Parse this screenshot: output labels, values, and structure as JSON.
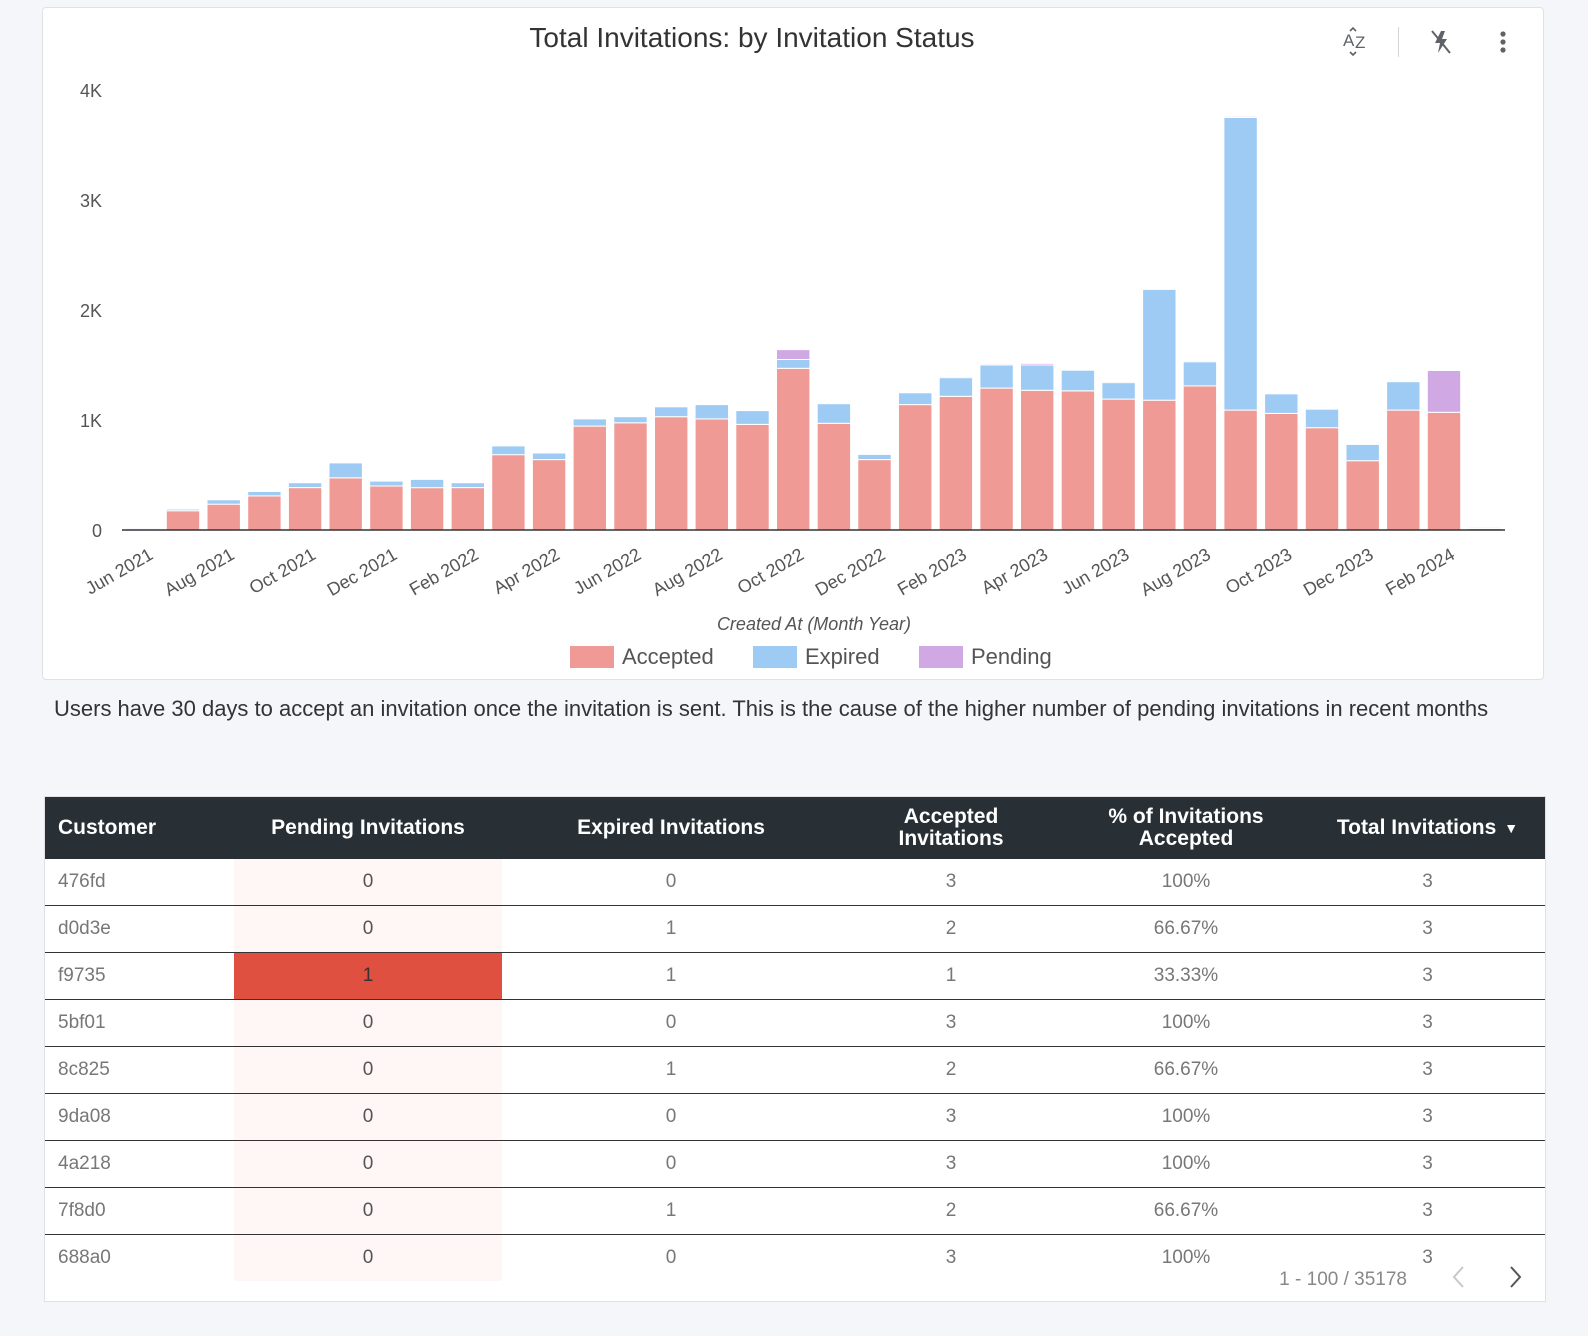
{
  "chart": {
    "title": "Total Invitations: by Invitation Status",
    "toolbar": {
      "sort_icon": "sort-az-icon",
      "filter_icon": "cross-filter-off-icon",
      "menu_icon": "more-vert-icon"
    }
  },
  "chart_data": {
    "type": "bar",
    "stacked": true,
    "title": "Total Invitations: by Invitation Status",
    "xlabel": "Created At (Month Year)",
    "ylabel": "",
    "ylim": [
      0,
      4000
    ],
    "y_ticks": [
      "0",
      "1K",
      "2K",
      "3K",
      "4K"
    ],
    "x_tick_labels": [
      "Jun 2021",
      "Aug 2021",
      "Oct 2021",
      "Dec 2021",
      "Feb 2022",
      "Apr 2022",
      "Jun 2022",
      "Aug 2022",
      "Oct 2022",
      "Dec 2022",
      "Feb 2023",
      "Apr 2023",
      "Jun 2023",
      "Aug 2023",
      "Oct 2023",
      "Dec 2023",
      "Feb 2024"
    ],
    "categories": [
      "Jun 2021",
      "Jul 2021",
      "Aug 2021",
      "Sep 2021",
      "Oct 2021",
      "Nov 2021",
      "Dec 2021",
      "Jan 2022",
      "Feb 2022",
      "Mar 2022",
      "Apr 2022",
      "May 2022",
      "Jun 2022",
      "Jul 2022",
      "Aug 2022",
      "Sep 2022",
      "Oct 2022",
      "Nov 2022",
      "Dec 2022",
      "Jan 2023",
      "Feb 2023",
      "Mar 2023",
      "Apr 2023",
      "May 2023",
      "Jun 2023",
      "Jul 2023",
      "Aug 2023",
      "Sep 2023",
      "Oct 2023",
      "Nov 2023",
      "Dec 2023",
      "Jan 2024",
      "Feb 2024",
      "Mar 2024"
    ],
    "series": [
      {
        "name": "Accepted",
        "color": "#ef9a94",
        "values": [
          10,
          175,
          235,
          310,
          385,
          475,
          400,
          385,
          385,
          685,
          640,
          945,
          975,
          1030,
          1010,
          960,
          1470,
          970,
          640,
          1140,
          1215,
          1290,
          1270,
          1265,
          1190,
          1180,
          1310,
          1090,
          1060,
          930,
          630,
          1090,
          1070,
          15
        ]
      },
      {
        "name": "Expired",
        "color": "#9dcbf3",
        "values": [
          10,
          15,
          40,
          40,
          45,
          135,
          45,
          75,
          45,
          80,
          60,
          65,
          55,
          90,
          130,
          125,
          80,
          180,
          50,
          110,
          170,
          210,
          230,
          190,
          150,
          1010,
          220,
          2660,
          180,
          170,
          150,
          260,
          0,
          10
        ]
      },
      {
        "name": "Pending",
        "color": "#d0a8e4",
        "values": [
          0,
          0,
          0,
          0,
          0,
          0,
          0,
          0,
          0,
          0,
          0,
          0,
          0,
          0,
          0,
          0,
          90,
          5,
          5,
          5,
          10,
          10,
          15,
          5,
          10,
          5,
          10,
          10,
          5,
          5,
          5,
          5,
          380,
          0
        ]
      }
    ],
    "legend": [
      "Accepted",
      "Expired",
      "Pending"
    ],
    "legend_position": "bottom",
    "grid": false
  },
  "note": "Users have 30 days to accept an invitation once the invitation is sent. This is the cause of the higher number of pending invitations in recent months",
  "table": {
    "headers": {
      "customer": "Customer",
      "pending": "Pending Invitations",
      "expired": "Expired Invitations",
      "accepted_1": "Accepted",
      "accepted_2": "Invitations",
      "pct_1": "% of Invitations",
      "pct_2": "Accepted",
      "total": "Total Invitations"
    },
    "sort_icon": "sort-desc-icon",
    "rows": [
      {
        "customer": "476fd",
        "pending": "0",
        "expired": "0",
        "accepted": "3",
        "pct": "100%",
        "total": "3"
      },
      {
        "customer": "d0d3e",
        "pending": "0",
        "expired": "1",
        "accepted": "2",
        "pct": "66.67%",
        "total": "3"
      },
      {
        "customer": "f9735",
        "pending": "1",
        "expired": "1",
        "accepted": "1",
        "pct": "33.33%",
        "total": "3"
      },
      {
        "customer": "5bf01",
        "pending": "0",
        "expired": "0",
        "accepted": "3",
        "pct": "100%",
        "total": "3"
      },
      {
        "customer": "8c825",
        "pending": "0",
        "expired": "1",
        "accepted": "2",
        "pct": "66.67%",
        "total": "3"
      },
      {
        "customer": "9da08",
        "pending": "0",
        "expired": "0",
        "accepted": "3",
        "pct": "100%",
        "total": "3"
      },
      {
        "customer": "4a218",
        "pending": "0",
        "expired": "0",
        "accepted": "3",
        "pct": "100%",
        "total": "3"
      },
      {
        "customer": "7f8d0",
        "pending": "0",
        "expired": "1",
        "accepted": "2",
        "pct": "66.67%",
        "total": "3"
      },
      {
        "customer": "688a0",
        "pending": "0",
        "expired": "0",
        "accepted": "3",
        "pct": "100%",
        "total": "3"
      }
    ],
    "pagination": "1 - 100 / 35178",
    "colors": {
      "header_bg": "#283035",
      "heat_high": "#e05040",
      "heat_low": "#fef7f6"
    }
  }
}
